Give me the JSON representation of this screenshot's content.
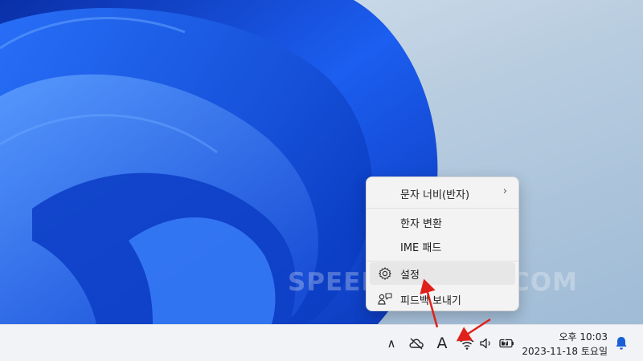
{
  "watermark": "SPEEDYGLAND.COM",
  "ime_menu": {
    "items": [
      {
        "label": "문자 너비(반자)",
        "has_submenu": true,
        "submenu_glyph": "›"
      },
      {
        "label": "한자 변환"
      },
      {
        "label": "IME 패드"
      },
      {
        "label": "설정",
        "icon": "gear-icon"
      },
      {
        "label": "피드백 보내기",
        "icon": "feedback-icon"
      }
    ]
  },
  "taskbar": {
    "tray_icons": [
      "chevron-up-icon",
      "cloud-offline-icon",
      "ime-mode-icon",
      "wifi-icon",
      "volume-icon",
      "battery-icon",
      "notification-bell-icon"
    ],
    "ime_mode_glyph": "A",
    "chevron_glyph": "∧",
    "clock": {
      "time": "오후 10:03",
      "date": "2023-11-18 토요일"
    }
  },
  "colors": {
    "annotation_arrow": "#e0201a",
    "accent": "#1a5fd6"
  }
}
